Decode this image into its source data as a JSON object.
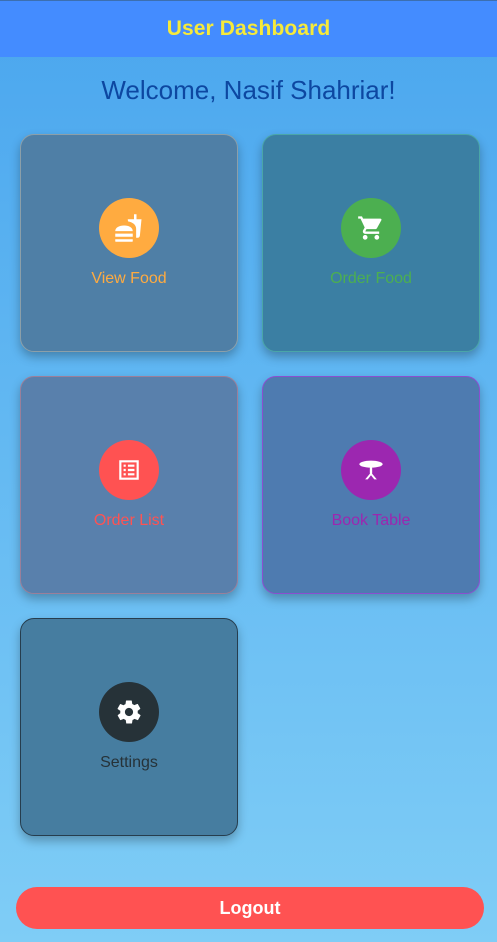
{
  "appbar": {
    "title": "User Dashboard"
  },
  "welcome": {
    "text": "Welcome, Nasif Shahriar!"
  },
  "tiles": [
    {
      "label": "View Food",
      "icon": "fastfood-icon",
      "color": "#ffab40"
    },
    {
      "label": "Order Food",
      "icon": "shopping-cart-icon",
      "color": "#4caf50"
    },
    {
      "label": "Order List",
      "icon": "list-icon",
      "color": "#ff5252"
    },
    {
      "label": "Book Table",
      "icon": "table-icon",
      "color": "#9c27b0"
    },
    {
      "label": "Settings",
      "icon": "gear-icon",
      "color": "#263238"
    }
  ],
  "logout": {
    "label": "Logout",
    "color": "#ff5252"
  },
  "colors": {
    "appbar": "#448cff",
    "appbar_title": "#f6ea3a",
    "welcome": "#0d47a1"
  }
}
